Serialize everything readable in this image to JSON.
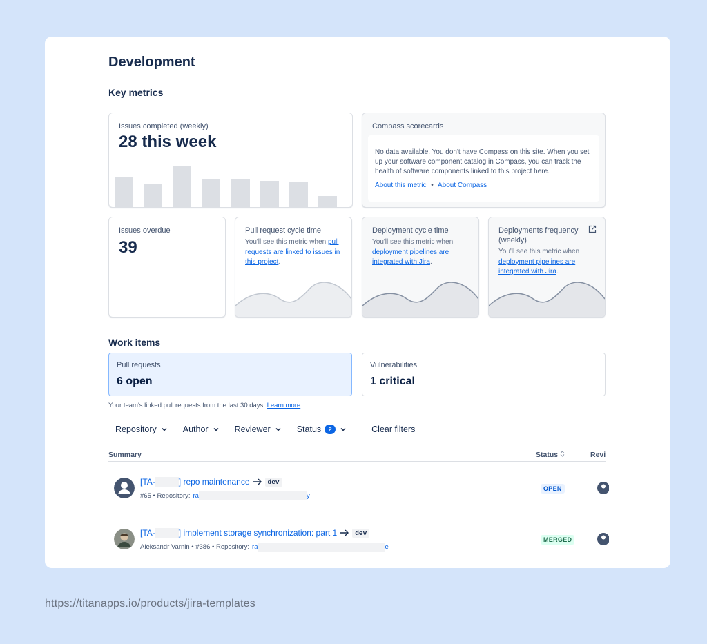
{
  "page": {
    "title": "Development",
    "key_metrics_title": "Key metrics",
    "work_items_title": "Work items"
  },
  "metrics": {
    "issues_completed": {
      "label": "Issues completed (weekly)",
      "value": "28 this week",
      "bars": [
        0.33,
        0.26,
        0.46,
        0.31,
        0.31,
        0.29,
        0.28,
        0.12
      ]
    },
    "compass": {
      "label": "Compass scorecards",
      "text": "No data available. You don't have Compass on this site. When you set up your software component catalog in Compass, you can track the health of software components linked to this project here.",
      "link_about_metric": "About this metric",
      "separator": "•",
      "link_about_compass": "About Compass"
    },
    "issues_overdue": {
      "label": "Issues overdue",
      "value": "39"
    },
    "pr_cycle": {
      "label": "Pull request cycle time",
      "hint_prefix": "You'll see this metric when",
      "hint_link": "pull requests are linked to issues in this project",
      "hint_suffix": "."
    },
    "deploy_cycle": {
      "label": "Deployment cycle time",
      "hint_prefix": "You'll see this metric when",
      "hint_link": "deployment pipelines are integrated with Jira",
      "hint_suffix": "."
    },
    "deploy_freq": {
      "label": "Deployments frequency (weekly)",
      "hint_prefix": "You'll see this metric when",
      "hint_link": "deployment pipelines are integrated with Jira",
      "hint_suffix": "."
    }
  },
  "work_items": {
    "pull_requests": {
      "label": "Pull requests",
      "value": "6 open"
    },
    "vulnerabilities": {
      "label": "Vulnerabilities",
      "value": "1 critical"
    },
    "note_text": "Your team's linked pull requests from the last 30 days.",
    "note_link": "Learn more"
  },
  "filters": {
    "repository": "Repository",
    "author": "Author",
    "reviewer": "Reviewer",
    "status": "Status",
    "status_count": "2",
    "clear": "Clear filters"
  },
  "table": {
    "col_summary": "Summary",
    "col_status": "Status",
    "col_reviewer": "Revi",
    "rows": [
      {
        "title_prefix": "[TA-",
        "title_suffix": "] repo maintenance",
        "branch": "dev",
        "meta_prefix": "#65 • Repository:",
        "repo_start": "ra",
        "repo_end": "y",
        "status": "OPEN"
      },
      {
        "title_prefix": "[TA-",
        "title_suffix": "] implement storage synchronization: part 1",
        "branch": "dev",
        "meta_prefix": "Aleksandr Varnin • #386 • Repository:",
        "repo_start": "ra",
        "repo_end": "e",
        "status": "MERGED"
      }
    ]
  },
  "footer": {
    "url": "https://titanapps.io/products/jira-templates"
  },
  "colors": {
    "background": "#d4e4fa",
    "link": "#0c66e4",
    "text": "#172b4d"
  }
}
